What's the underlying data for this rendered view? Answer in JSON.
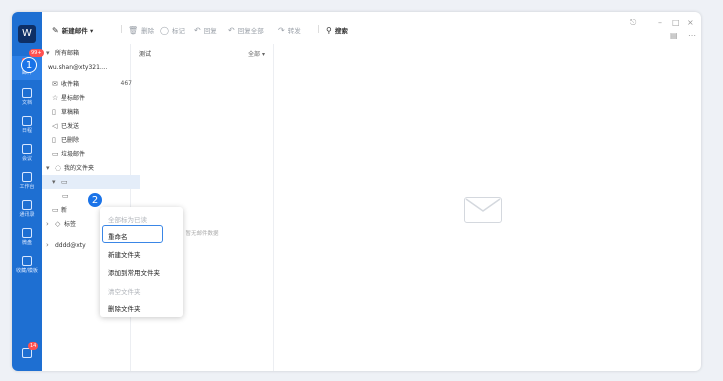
{
  "nav": {
    "avatar_text": "W",
    "mail_badge": "99+",
    "bottom_badge": "14",
    "items": [
      {
        "label": "邮件"
      },
      {
        "label": "文档"
      },
      {
        "label": "日程"
      },
      {
        "label": "会议"
      },
      {
        "label": "工作台"
      },
      {
        "label": "通讯录"
      },
      {
        "label": "微盘"
      },
      {
        "label": "收藏/模板"
      }
    ]
  },
  "steps": {
    "one": "1",
    "two": "2"
  },
  "toolbar": {
    "compose": "新建邮件",
    "delete": "删除",
    "read": "标记",
    "reply": "回复",
    "reply_all": "回复全部",
    "forward": "转发",
    "search": "搜索"
  },
  "folders": {
    "all_mail": "所有邮箱",
    "account": "wu.shan@xty321....",
    "inbox": "收件箱",
    "inbox_count": "467",
    "starred": "星标邮件",
    "drafts": "草稿箱",
    "sent": "已发送",
    "deleted": "已删除",
    "junk": "垃圾邮件",
    "my_folders": "我的文件夹",
    "tags": "标签",
    "account2": "dddd@xty",
    "new_folder_partial": "新"
  },
  "maillist": {
    "title": "测试",
    "filter": "全部",
    "empty": "暂无邮件数据"
  },
  "context_menu": {
    "mark_all_read": "全部标为已读",
    "rename": "重命名",
    "new_folder": "新建文件夹",
    "add_common": "添加到常用文件夹",
    "empty_folder": "清空文件夹",
    "delete_folder": "删除文件夹"
  }
}
